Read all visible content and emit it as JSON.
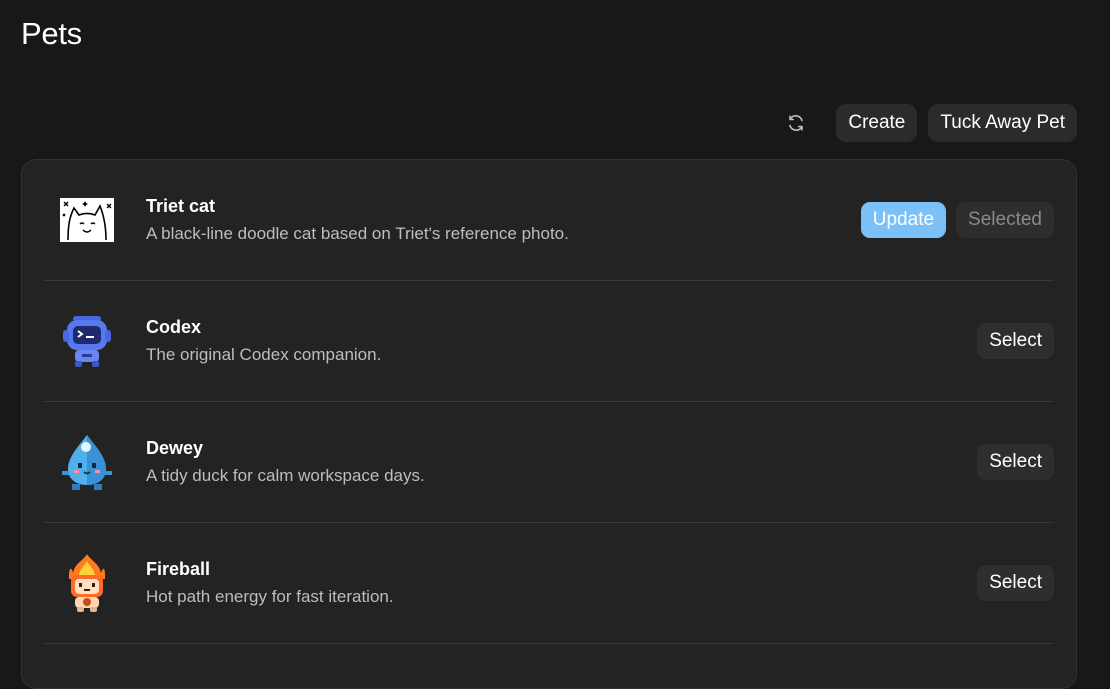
{
  "page": {
    "title": "Pets"
  },
  "toolbar": {
    "refresh_icon": "refresh-icon",
    "create_label": "Create",
    "tuck_label": "Tuck Away Pet"
  },
  "pets": [
    {
      "name": "Triet cat",
      "description": "A black-line doodle cat based on Triet's reference photo.",
      "icon": "doodle-cat-icon",
      "update_label": "Update",
      "status_label": "Selected"
    },
    {
      "name": "Codex",
      "description": "The original Codex companion.",
      "icon": "codex-robot-icon",
      "action_label": "Select"
    },
    {
      "name": "Dewey",
      "description": "A tidy duck for calm workspace days.",
      "icon": "water-drop-icon",
      "action_label": "Select"
    },
    {
      "name": "Fireball",
      "description": "Hot path energy for fast iteration.",
      "icon": "fireball-icon",
      "action_label": "Select"
    }
  ],
  "colors": {
    "background": "#181818",
    "panel": "#232323",
    "accent": "#7cc0f8",
    "button": "#2e2e2e"
  }
}
